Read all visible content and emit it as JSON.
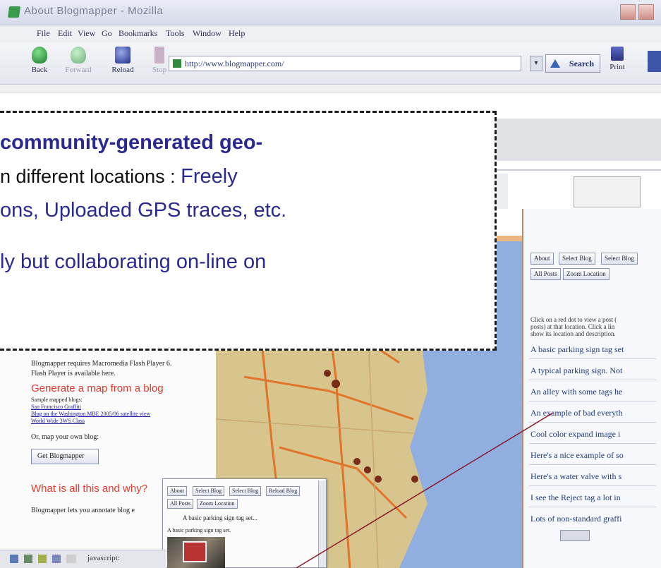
{
  "window": {
    "title": "About Blogmapper - Mozilla"
  },
  "menu": [
    "File",
    "Edit",
    "View",
    "Go",
    "Bookmarks",
    "Tools",
    "Window",
    "Help"
  ],
  "toolbar": {
    "back": "Back",
    "forward": "Forward",
    "reload": "Reload",
    "stop": "Stop",
    "url": "http://www.blogmapper.com/",
    "search": "Search",
    "print": "Print"
  },
  "overlay": {
    "line1": "community-generated geo-",
    "line2_black": "n different locations : ",
    "line2_blue": "Freely",
    "line3": "ons, Uploaded GPS traces, etc.",
    "line4": "ly but collaborating on-line on"
  },
  "sidebar": {
    "buttons_row1": [
      "About",
      "Select Blog",
      "Select Blog"
    ],
    "buttons_row2": [
      "All Posts",
      "Zoom Location"
    ],
    "instructions": [
      "Click on a red dot to view a post (",
      "posts) at that location. Click a lin",
      "show its location and description."
    ],
    "posts": [
      "A basic parking sign tag set",
      "A typical parking sign. Not",
      "An alley with some tags he",
      "An example of bad everyth",
      "Cool color expand image i",
      "Here's a nice example of so",
      "Here's a water valve with s",
      "I see the Reject tag a lot in",
      "Lots of non-standard graffi"
    ]
  },
  "left_frame": {
    "requires": "Blogmapper requires Macromedia Flash Player 6.",
    "flash_available": "Flash Player is available here.",
    "generate_heading": "Generate a map from a blog",
    "sample_label": "Sample mapped blogs:",
    "sample_links": [
      "San Francisco Graffiti",
      "Blog on the Washington MBE 2005/06 satellite view",
      "World Wide 3WS Class"
    ],
    "or_map": "Or, map your own blog:",
    "get_button": "Get Blogmapper",
    "what_heading": "What is all this and why?",
    "description": "Blogmapper lets you annotate blog e"
  },
  "popup": {
    "buttons_row1": [
      "About",
      "Select Blog",
      "Select Blog",
      "Reload Blog"
    ],
    "buttons_row2": [
      "All Posts",
      "Zoom Location"
    ],
    "title": "A basic parking sign tag set...",
    "caption": "A basic parking sign tag set."
  },
  "status": {
    "text": "javascript:"
  },
  "colors": {
    "overlay_blue": "#2a2891",
    "map_water": "#90aee0",
    "map_land": "#d8c58e",
    "road": "#e0752a",
    "pin": "#7a2a18",
    "pointer_line": "#8b1a2a"
  }
}
